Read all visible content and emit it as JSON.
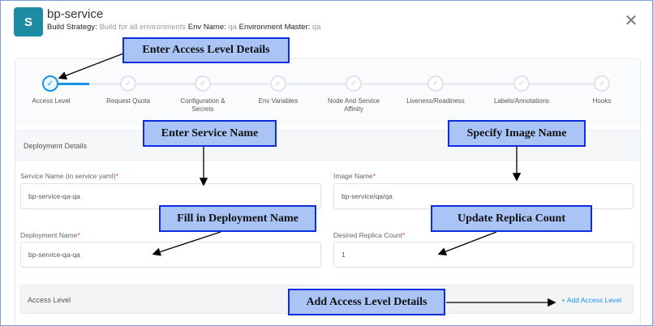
{
  "header": {
    "avatar_letter": "S",
    "title": "bp-service",
    "build_strategy_label": "Build Strategy:",
    "build_strategy_value": "Build for all environments",
    "env_name_label": "Env Name:",
    "env_name_value": "qa",
    "env_master_label": "Environment Master:",
    "env_master_value": "qa",
    "close_icon": "close-icon"
  },
  "stepper": {
    "steps": [
      {
        "label": "Access Level",
        "state": "active"
      },
      {
        "label": "Request Quota",
        "state": "pending"
      },
      {
        "label": "Configuration & Secrets",
        "state": "pending"
      },
      {
        "label": "Env Variables",
        "state": "pending"
      },
      {
        "label": "Node And Service Affinity",
        "state": "pending"
      },
      {
        "label": "Liveness/Readiness",
        "state": "pending"
      },
      {
        "label": "Labels/Annotations",
        "state": "pending"
      },
      {
        "label": "Hooks",
        "state": "pending"
      }
    ],
    "check_glyph": "✓"
  },
  "deployment": {
    "section_title": "Deployment Details",
    "service_name_label": "Service Name (in service yaml)",
    "service_name_value": "bp-service-qa-qa",
    "image_name_label": "Image Name",
    "image_name_value": "bp-service/qa/qa",
    "deployment_name_label": "Deployment Name",
    "deployment_name_value": "bp-service-qa-qa",
    "replica_count_label": "Desired Replica Count",
    "replica_count_value": "1",
    "required_mark": "*"
  },
  "access_level": {
    "title": "Access Level",
    "add_link": "+ Add Access Level"
  },
  "callouts": {
    "access_details": "Enter Access Level Details",
    "service_name": "Enter Service Name",
    "image_name": "Specify Image Name",
    "deployment_name": "Fill in Deployment Name",
    "replica_count": "Update Replica Count",
    "add_access": "Add Access Level Details"
  },
  "colors": {
    "accent": "#1b91e3",
    "avatar": "#1d8ca3",
    "callout_fill": "#a9c4f5",
    "callout_border": "#0d2fe0"
  }
}
